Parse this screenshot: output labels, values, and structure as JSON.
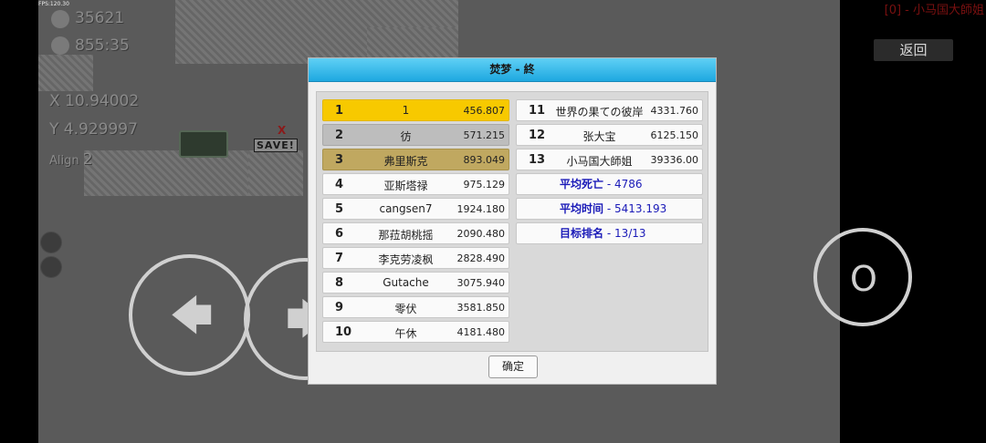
{
  "hud": {
    "fps": "FPS:120.30",
    "deaths": "35621",
    "time": "855:35",
    "x": "X 10.94002",
    "y": "Y 4.929997",
    "align_label": "Align",
    "align_value": "2",
    "save_label": "SAVE!",
    "save_x": "X",
    "corner_title": "[0] - 小马国大師姐"
  },
  "controls": {
    "back_label": "返回",
    "action_label": "O",
    "left_arrow": "🡄",
    "right_arrow": "🡆"
  },
  "dialog": {
    "title": "焚梦 - 終",
    "confirm_label": "确定",
    "left_ranking": [
      {
        "rank": "1",
        "name": "1",
        "time": "456.807",
        "style": "gold"
      },
      {
        "rank": "2",
        "name": "彷",
        "time": "571.215",
        "style": "silver"
      },
      {
        "rank": "3",
        "name": "弗里斯克",
        "time": "893.049",
        "style": "bronze"
      },
      {
        "rank": "4",
        "name": "亚斯塔禄",
        "time": "975.129",
        "style": "plain"
      },
      {
        "rank": "5",
        "name": "cangsen7",
        "time": "1924.180",
        "style": "plain"
      },
      {
        "rank": "6",
        "name": "那菈胡桃摇",
        "time": "2090.480",
        "style": "plain"
      },
      {
        "rank": "7",
        "name": "李克劳凌枫",
        "time": "2828.490",
        "style": "plain"
      },
      {
        "rank": "8",
        "name": "Gutache",
        "time": "3075.940",
        "style": "plain"
      },
      {
        "rank": "9",
        "name": "零伏",
        "time": "3581.850",
        "style": "plain"
      },
      {
        "rank": "10",
        "name": "午休",
        "time": "4181.480",
        "style": "plain"
      }
    ],
    "right_ranking": [
      {
        "rank": "11",
        "name": "世界の果ての彼岸",
        "time": "4331.760",
        "style": "plain"
      },
      {
        "rank": "12",
        "name": "张大宝",
        "time": "6125.150",
        "style": "plain"
      },
      {
        "rank": "13",
        "name": "小马国大師姐",
        "time": "39336.00",
        "style": "plain"
      }
    ],
    "stats": [
      {
        "label": "平均死亡",
        "value": " - 4786"
      },
      {
        "label": "平均时间",
        "value": " - 5413.193"
      },
      {
        "label": "目标排名",
        "value": " - 13/13"
      }
    ]
  }
}
